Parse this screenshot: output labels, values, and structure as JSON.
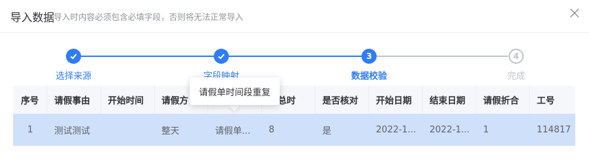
{
  "dialog": {
    "title": "导入数据",
    "subtitle": "导入时内容必须包含必填字段，否则将无法正常导入"
  },
  "steps": [
    {
      "label": "选择来源",
      "number": "",
      "state": "done"
    },
    {
      "label": "字段映射",
      "number": "",
      "state": "done"
    },
    {
      "label": "数据校验",
      "number": "3",
      "state": "active"
    },
    {
      "label": "完成",
      "number": "4",
      "state": "pending"
    }
  ],
  "tooltip": {
    "text": "请假单时间段重复"
  },
  "table": {
    "headers": [
      "序号",
      "请假事由",
      "开始时间",
      "请假方",
      "",
      "假总时",
      "是否核对",
      "开始日期",
      "结束日期",
      "请假折合",
      "工号"
    ],
    "rows": [
      [
        "1",
        "测试测试",
        "",
        "整天",
        "请假单...",
        "8",
        "是",
        "2022-1...",
        "2022-1...",
        "1",
        "114817"
      ]
    ]
  },
  "colors": {
    "accent": "#2f7cf6",
    "pending": "#c0c4cc",
    "selected_row": "#cfe0fb",
    "header_bg": "#f5f7fa"
  }
}
